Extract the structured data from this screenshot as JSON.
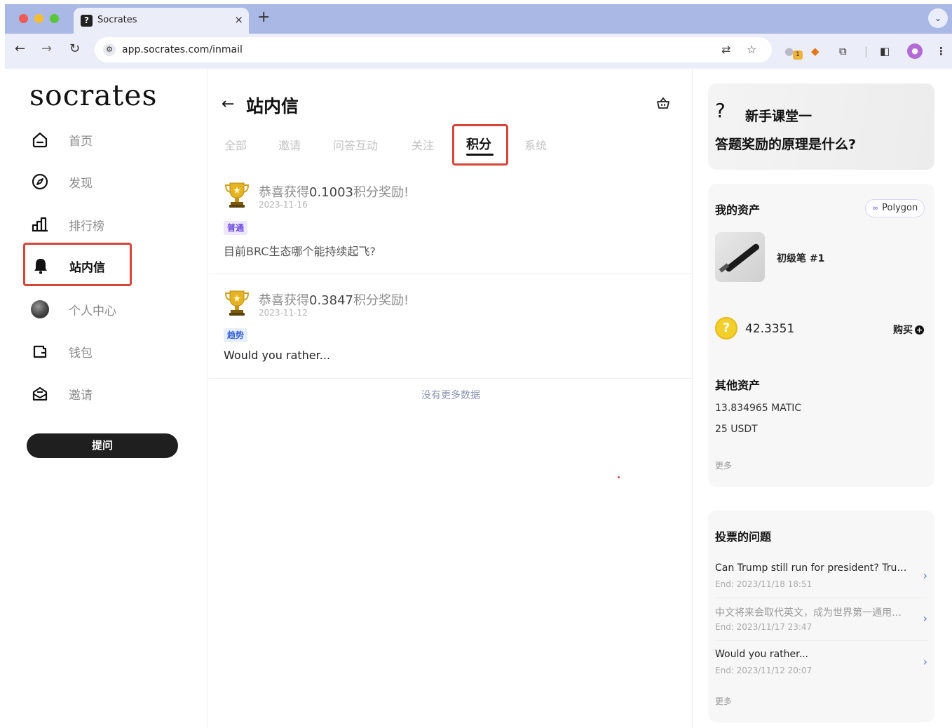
{
  "browser": {
    "tab_title": "Socrates",
    "tab_favicon": "?",
    "tab_close": "×",
    "new_tab": "+",
    "tab_menu": "⌄",
    "url": "app.socrates.com/inmail",
    "extension_badge": "1",
    "icons": [
      "back-icon",
      "forward-icon",
      "reload-icon",
      "site-settings-icon",
      "translate-icon",
      "bookmark-star-icon",
      "extension-coin-icon",
      "metamask-icon",
      "extensions-puzzle-icon",
      "sidepanel-icon",
      "profile-icon",
      "kebab-menu-icon"
    ]
  },
  "sidebar": {
    "logo": "socrates",
    "items": [
      {
        "label": "首页",
        "icon": "home-icon"
      },
      {
        "label": "发现",
        "icon": "compass-icon"
      },
      {
        "label": "排行榜",
        "icon": "bar-chart-icon"
      },
      {
        "label": "站内信",
        "icon": "bell-icon",
        "active": true
      },
      {
        "label": "个人中心",
        "icon": "avatar-icon"
      },
      {
        "label": "钱包",
        "icon": "wallet-icon"
      },
      {
        "label": "邀请",
        "icon": "invite-mail-icon"
      }
    ],
    "ask_button": "提问"
  },
  "main": {
    "title": "站内信",
    "tabs": [
      "全部",
      "邀请",
      "问答互动",
      "关注",
      "积分",
      "系统"
    ],
    "active_tab": "积分",
    "messages": [
      {
        "title_prefix": "恭喜获得",
        "amount": "0.1003",
        "title_suffix": "积分奖励!",
        "date": "2023-11-16",
        "tag": "普通",
        "tag_color": "#6f4be0",
        "body": "目前BRC生态哪个能持续起飞?"
      },
      {
        "title_prefix": "恭喜获得",
        "amount": "0.3847",
        "title_suffix": "积分奖励!",
        "date": "2023-11-12",
        "tag": "趋势",
        "tag_color": "#3b62d8",
        "body": "Would you rather..."
      }
    ],
    "no_more": "没有更多数据"
  },
  "right": {
    "banner": {
      "line1": "新手课堂一",
      "line2": "答题奖励的原理是什么?"
    },
    "assets": {
      "title": "我的资产",
      "chain": "Polygon",
      "nft_name": "初级笔 #1",
      "coin_symbol": "?",
      "balance": "42.3351",
      "buy_label": "购买",
      "other_title": "其他资产",
      "other": [
        "13.834965 MATIC",
        "25 USDT"
      ],
      "more": "更多"
    },
    "votes": {
      "title": "投票的问题",
      "items": [
        {
          "question": "Can Trump still run for president? Trump is...",
          "end": "End: 2023/11/18 18:51",
          "muted": false
        },
        {
          "question": "中文将来会取代英文，成为世界第一通用语言吗?",
          "end": "End: 2023/11/17 23:47",
          "muted": true
        },
        {
          "question": "Would you rather...",
          "end": "End: 2023/11/12 20:07",
          "muted": false
        }
      ],
      "more": "更多"
    }
  },
  "colors": {
    "highlight": "#d4453a",
    "accent": "#5b76e2",
    "tabbar": "#aab8e6"
  }
}
